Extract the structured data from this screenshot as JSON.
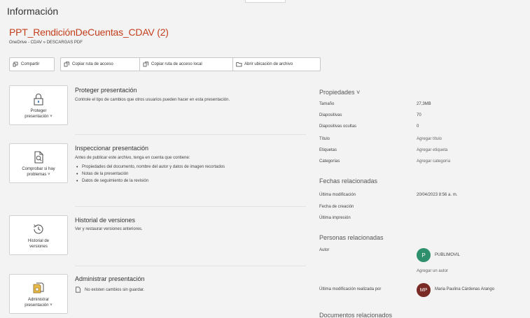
{
  "page": {
    "title": "Información"
  },
  "file": {
    "name": "PPT_RendiciónDeCuentas_CDAV (2)",
    "path": "OneDrive - CDAV » DESCARGAS PDF"
  },
  "actions": [
    {
      "label": "Compartir",
      "icon": "share-icon"
    },
    {
      "label": "Copiar ruta de acceso",
      "icon": "copy-path-icon"
    },
    {
      "label": "Copiar ruta de acceso local",
      "icon": "copy-local-path-icon"
    },
    {
      "label": "Abrir ubicación de archivo",
      "icon": "folder-icon"
    }
  ],
  "sections": {
    "protect": {
      "button_label_1": "Proteger",
      "button_label_2": "presentación ˅",
      "title": "Proteger presentación",
      "text": "Controle el tipo de cambios que otros usuarios pueden hacer en esta presentación."
    },
    "inspect": {
      "button_label_1": "Comprobar si hay",
      "button_label_2": "problemas ˅",
      "title": "Inspeccionar presentación",
      "text": "Antes de publicar este archivo, tenga en cuenta que contiene:",
      "bullets": [
        "Propiedades del documento, nombre del autor y datos de imagen recortados",
        "Notas de la presentación",
        "Datos de seguimiento de la revisión"
      ]
    },
    "versions": {
      "button_label_1": "Historial de",
      "button_label_2": "versiones",
      "title": "Historial de versiones",
      "text": "Ver y restaurar versiones anteriores."
    },
    "manage": {
      "button_label_1": "Administrar",
      "button_label_2": "presentación ˅",
      "title": "Administrar presentación",
      "text": "No existen cambios sin guardar."
    }
  },
  "properties": {
    "heading": "Propiedades ˅",
    "rows": [
      {
        "label": "Tamaño",
        "value": "27,3MB"
      },
      {
        "label": "Diapositivas",
        "value": "70"
      },
      {
        "label": "Diapositivas ocultas",
        "value": "0"
      },
      {
        "label": "Título",
        "value": "Agregar título"
      },
      {
        "label": "Etiquetas",
        "value": "Agregar etiqueta"
      },
      {
        "label": "Categorías",
        "value": "Agregar categoría"
      }
    ]
  },
  "dates": {
    "heading": "Fechas relacionadas",
    "rows": [
      {
        "label": "Última modificación",
        "value": "20/04/2023 8:56 a. m."
      },
      {
        "label": "Fecha de creación",
        "value": ""
      },
      {
        "label": "Última impresión",
        "value": ""
      }
    ]
  },
  "people": {
    "heading": "Personas relacionadas",
    "author_label": "Autor",
    "author_initial": "P",
    "author_name": "PUBLIMOVIL",
    "add_author": "Agregar un autor",
    "modified_by_label": "Última modificación realizada por",
    "modifier_initials": "MP",
    "modifier_name": "Maria Paulina Cárdenas Arango",
    "author_color": "#2e8f6d",
    "modifier_color": "#7a2a24"
  },
  "documents": {
    "heading": "Documentos relacionados"
  },
  "colors": {
    "accent": "#c43e1c"
  }
}
